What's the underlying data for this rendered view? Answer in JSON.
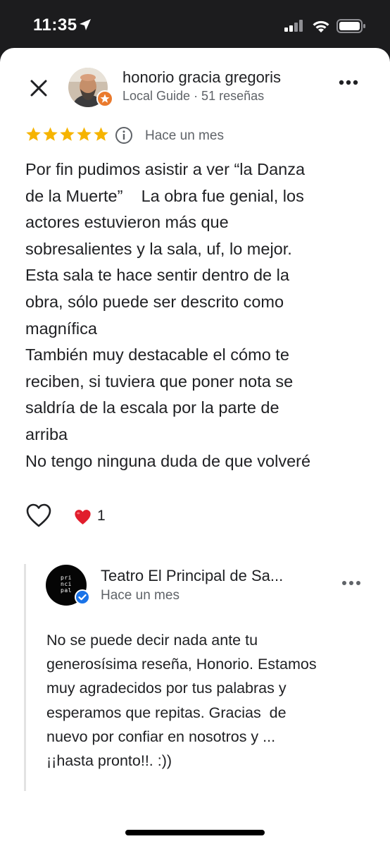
{
  "status_bar": {
    "time": "11:35"
  },
  "review": {
    "reviewer_name": "honorio gracia gregoris",
    "reviewer_meta": "Local Guide · 51 reseñas",
    "rating": 5,
    "date": "Hace un mes",
    "text": "Por fin pudimos asistir a ver “la Danza\nde la Muerte”    La obra fue genial, los\nactores estuvieron más que\nsobresalientes y la sala, uf, lo mejor.\nEsta sala te hace sentir dentro de la\nobra, sólo puede ser descrito como\nmagnífica\nTambién muy destacable el cómo te\nreciben, si tuviera que poner nota se\nsaldría de la escala por la parte de\narriba\nNo tengo ninguna duda de que volveré",
    "reaction_count": "1"
  },
  "reply": {
    "owner_name": "Teatro El Principal de Sa...",
    "owner_logo_text": "pri\nnci\npal",
    "date": "Hace un mes",
    "text": "No se puede decir nada ante tu\ngenerosísima reseña, Honorio. Estamos\nmuy agradecidos por tus palabras y\nesperamos que repitas. Gracias  de\nnuevo por confiar en nosotros y ...\n¡¡hasta pronto!!. :))"
  },
  "colors": {
    "star": "#f6b400",
    "local_guide_badge": "#ea7a2d",
    "verified_badge": "#1a73e8",
    "reaction_heart": "#e11d2c"
  },
  "icons": {
    "close": "close-icon",
    "more": "more-horizontal-icon",
    "info": "info-icon",
    "like": "heart-outline-icon",
    "reaction": "heart-filled-icon",
    "verified": "verified-check-icon"
  }
}
